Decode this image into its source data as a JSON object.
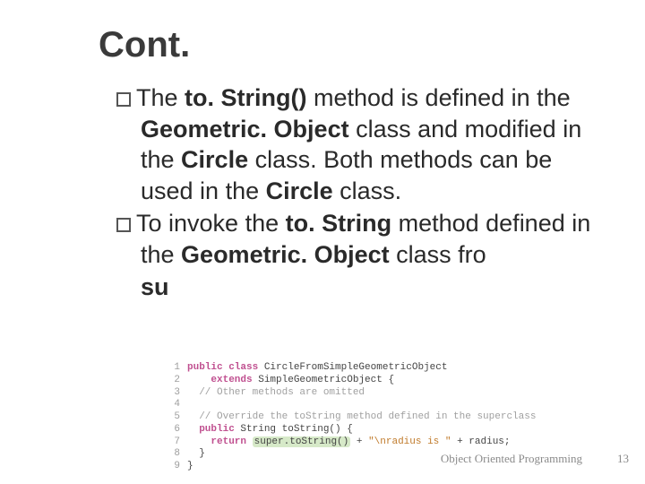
{
  "title": "Cont.",
  "bullets": [
    {
      "pre": "The ",
      "b1": "to. String()",
      "mid1": " method is defined in the ",
      "b2": "Geometric. Object",
      "mid2": " class and modified in the ",
      "b3": "Circle",
      "mid3": " class. Both methods can be used in the ",
      "b4": "Circle",
      "post": " class."
    },
    {
      "pre": "To invoke the ",
      "b1": "to. String",
      "mid1": " method defined in the ",
      "b2": "Geometric. Object",
      "mid2": " class fro",
      "b3": "",
      "mid3": "",
      "b4": "",
      "post": ""
    }
  ],
  "stray_su": "su",
  "code": {
    "l1_kw1": "public class",
    "l1_rest": " CircleFromSimpleGeometricObject",
    "l2_kw": "extends",
    "l2_rest": " SimpleGeometricObject {",
    "l3": "// Other methods are omitted",
    "l5": "// Override the toString method defined in the superclass",
    "l6_kw": "public",
    "l6_rest": " String toString() {",
    "l7_kw": "return",
    "l7_call": "super.toString()",
    "l7_plus": " + ",
    "l7_str": "\"\\nradius is \"",
    "l7_tail": " + radius;",
    "l8": "}",
    "l9": "}"
  },
  "footer": "Object Oriented Programming",
  "pagenum": "13"
}
